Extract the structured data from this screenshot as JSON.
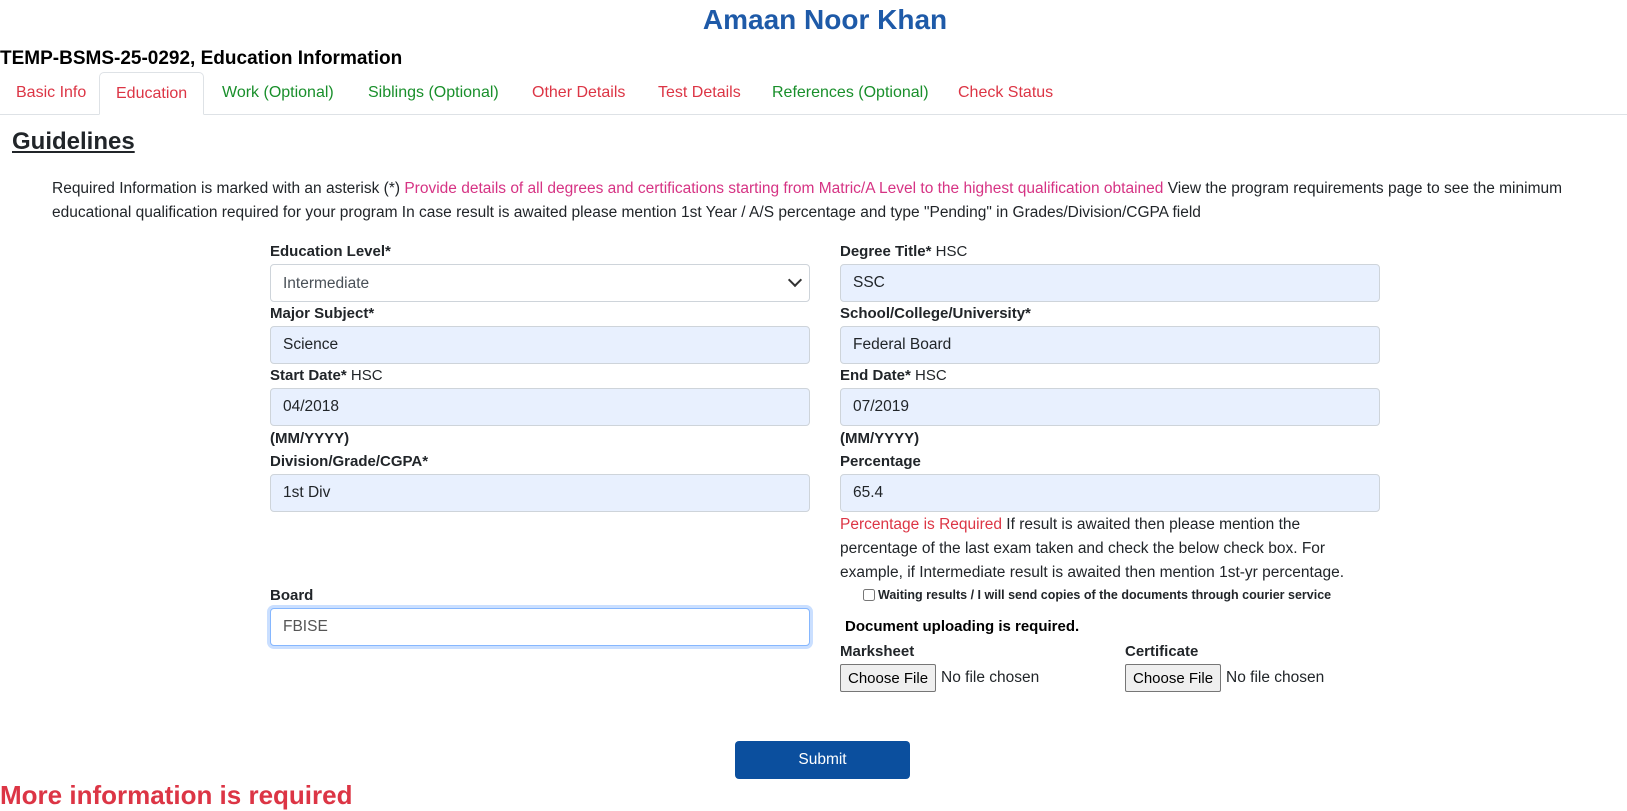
{
  "header": {
    "name": "Amaan Noor Khan",
    "application": "TEMP-BSMS-25-0292, Education Information"
  },
  "tabs": [
    {
      "label": "Basic Info",
      "color": "#dc3545"
    },
    {
      "label": "Education",
      "color": "#dc3545",
      "active": true
    },
    {
      "label": "Work (Optional)",
      "color": "#198f2b"
    },
    {
      "label": "Siblings (Optional)",
      "color": "#198f2b"
    },
    {
      "label": "Other Details",
      "color": "#dc3545"
    },
    {
      "label": "Test Details",
      "color": "#dc3545"
    },
    {
      "label": "References (Optional)",
      "color": "#198f2b"
    },
    {
      "label": "Check Status",
      "color": "#dc3545"
    }
  ],
  "guidelines": {
    "heading": "Guidelines",
    "intro": "Required Information is marked with an asterisk (*) ",
    "highlight": "Provide details of all degrees and certifications starting from Matric/A Level to the highest qualification obtained",
    "rest": " View the program requirements page to see the minimum educational qualification required for your program In case result is awaited please mention 1st Year / A/S percentage and type \"Pending\" in Grades/Division/CGPA field"
  },
  "form": {
    "education_level": {
      "label": "Education Level*",
      "value": "Intermediate"
    },
    "degree_title": {
      "label": "Degree Title*",
      "hint": " HSC",
      "value": "SSC"
    },
    "major_subject": {
      "label": "Major Subject*",
      "value": "Science"
    },
    "school": {
      "label": "School/College/University*",
      "value": "Federal Board"
    },
    "start_date": {
      "label": "Start Date*",
      "hint": " HSC",
      "value": "04/2018",
      "format": "(MM/YYYY)"
    },
    "end_date": {
      "label": "End Date*",
      "hint": " HSC",
      "value": "07/2019",
      "format": "(MM/YYYY)"
    },
    "division": {
      "label": "Division/Grade/CGPA*",
      "value": "1st Div"
    },
    "percentage": {
      "label": "Percentage",
      "value": "65.4",
      "error": "Percentage is Required",
      "note": " If result is awaited then please mention the percentage of the last exam taken and check the below check box. For example, if Intermediate result is awaited then mention 1st-yr percentage."
    },
    "waiting_checkbox": {
      "label": "Waiting results / I will send copies of the documents through courier service",
      "checked": false
    },
    "board": {
      "label": "Board",
      "value": "FBISE"
    },
    "documents": {
      "required_text": "Document uploading is required.",
      "marksheet": {
        "label": "Marksheet",
        "button": "Choose File",
        "status": "No file chosen"
      },
      "certificate": {
        "label": "Certificate",
        "button": "Choose File",
        "status": "No file chosen"
      }
    },
    "submit_label": "Submit"
  },
  "footer_error": "More information is required"
}
